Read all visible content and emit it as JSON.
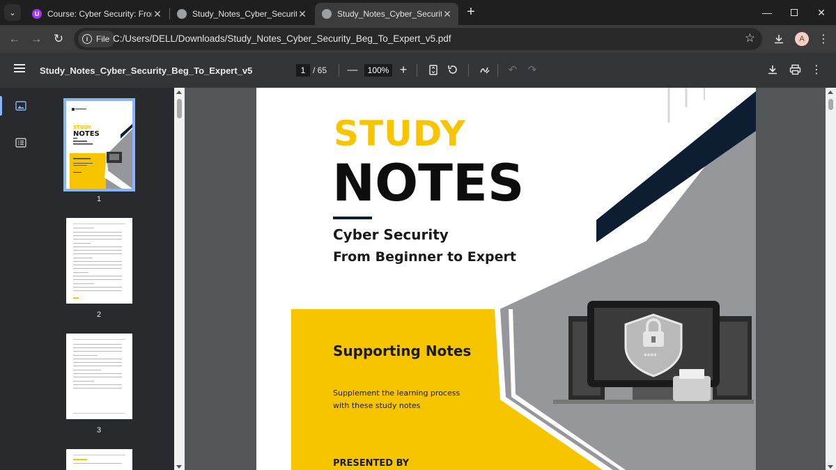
{
  "browser": {
    "tabs": [
      {
        "title": "Course: Cyber Security: From Beg",
        "icon": "udemy-icon"
      },
      {
        "title": "Study_Notes_Cyber_Security_Beg",
        "icon": "globe-icon"
      },
      {
        "title": "Study_Notes_Cyber_Security_Beg",
        "icon": "globe-icon"
      }
    ],
    "omnibox": {
      "chip_label": "File",
      "url": "C:/Users/DELL/Downloads/Study_Notes_Cyber_Security_Beg_To_Expert_v5.pdf"
    },
    "profile_initial": "A"
  },
  "pdf_toolbar": {
    "title": "Study_Notes_Cyber_Security_Beg_To_Expert_v5",
    "current_page": "1",
    "total_pages": "/ 65",
    "zoom": "100%"
  },
  "thumbnails": [
    {
      "label": "1"
    },
    {
      "label": "2"
    },
    {
      "label": "3"
    }
  ],
  "page": {
    "study": "STUDY",
    "notes": "NOTES",
    "subtitle_1": "Cyber Security",
    "subtitle_2": "From Beginner to Expert",
    "supporting": "Supporting Notes",
    "supplement_1": "Supplement  the  learning  process",
    "supplement_2": "with these study notes",
    "presented_by": "PRESENTED BY"
  },
  "colors": {
    "accent_yellow": "#f6c500",
    "navy": "#0d1e33",
    "gray_panel": "#96979b",
    "selection_blue": "#8ab4f8"
  }
}
